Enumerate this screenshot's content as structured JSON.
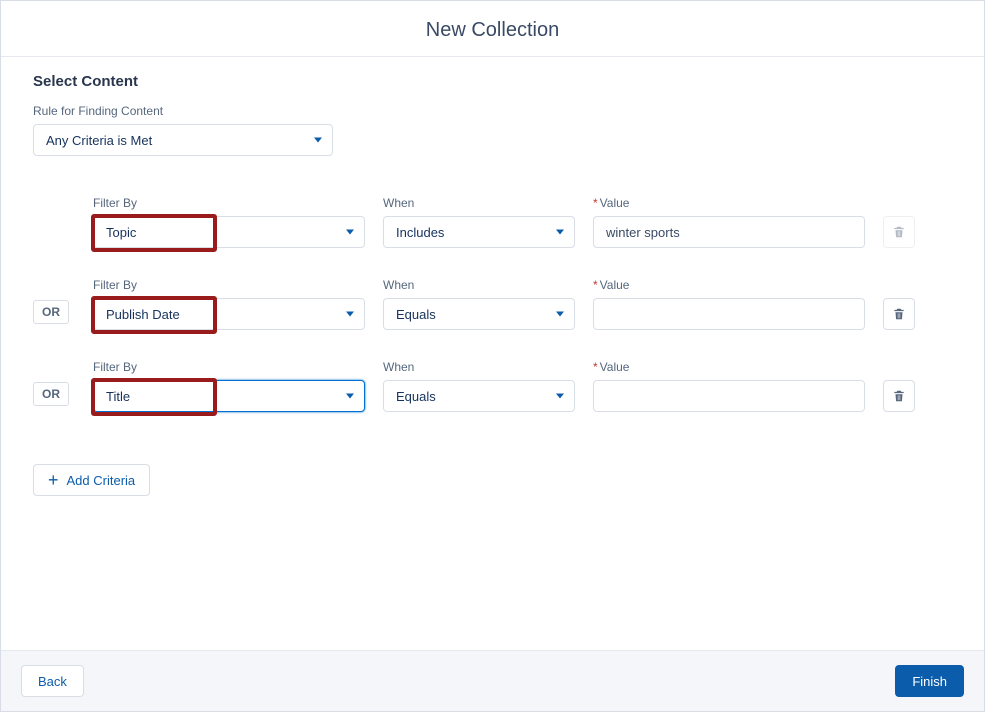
{
  "header": {
    "title": "New Collection"
  },
  "section": {
    "title": "Select Content"
  },
  "ruleSelect": {
    "label": "Rule for Finding Content",
    "value": "Any Criteria is Met"
  },
  "labels": {
    "filterBy": "Filter By",
    "when": "When",
    "value": "Value",
    "or": "OR"
  },
  "rows": [
    {
      "filter": "Topic",
      "when": "Includes",
      "value": "winter sports",
      "showOr": false,
      "highlight": true,
      "deleteDisabled": true,
      "filterFocused": false
    },
    {
      "filter": "Publish Date",
      "when": "Equals",
      "value": "",
      "showOr": true,
      "highlight": true,
      "deleteDisabled": false,
      "filterFocused": false
    },
    {
      "filter": "Title",
      "when": "Equals",
      "value": "",
      "showOr": true,
      "highlight": true,
      "deleteDisabled": false,
      "filterFocused": true
    }
  ],
  "addButton": {
    "label": "Add Criteria"
  },
  "footer": {
    "back": "Back",
    "finish": "Finish"
  }
}
